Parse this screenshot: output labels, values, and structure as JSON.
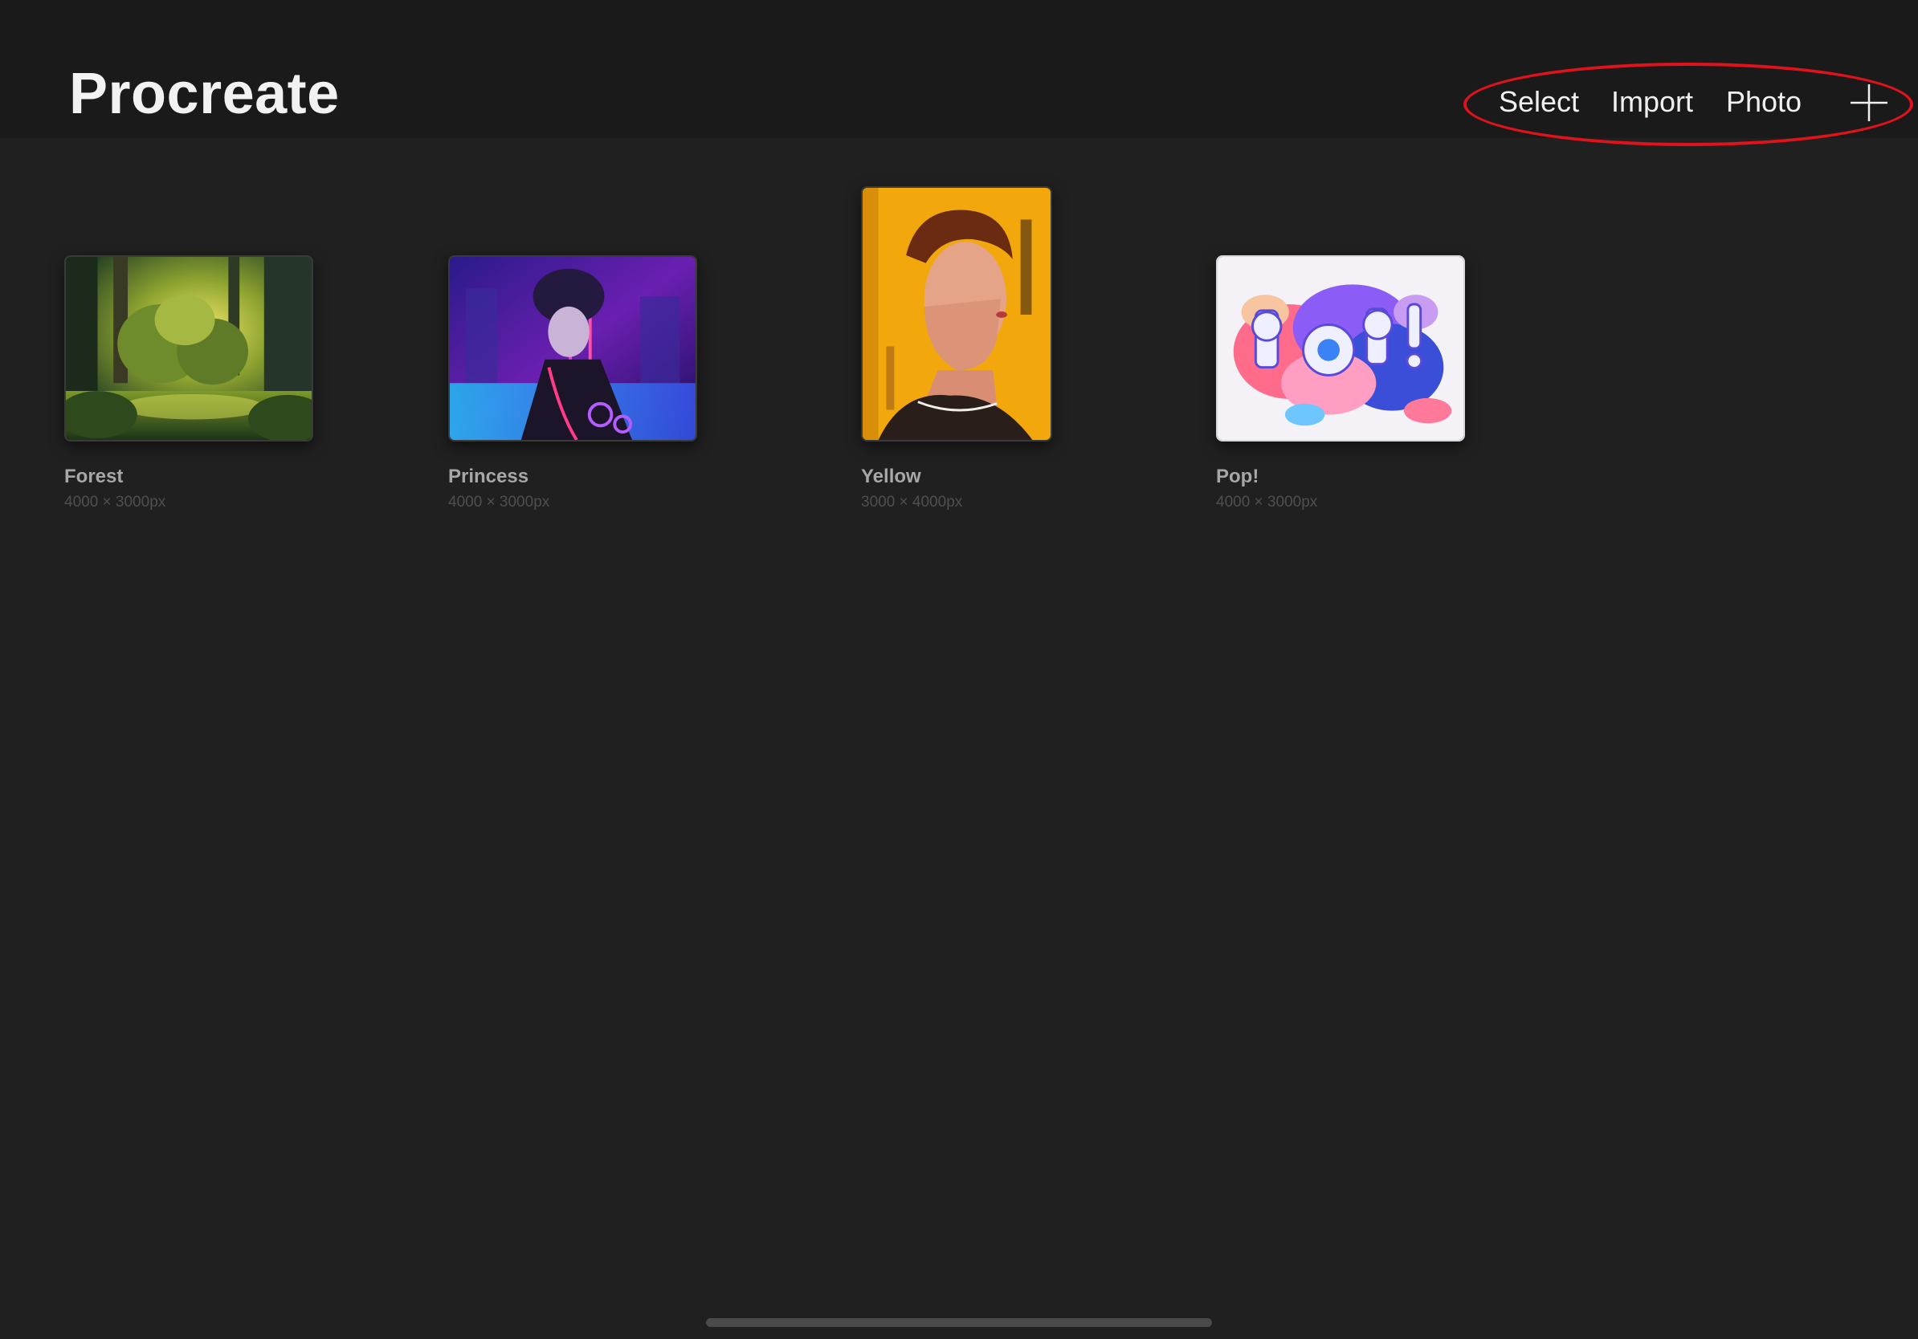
{
  "app": {
    "title": "Procreate"
  },
  "toolbar": {
    "select_label": "Select",
    "import_label": "Import",
    "photo_label": "Photo",
    "new_icon": "plus-icon"
  },
  "colors": {
    "background": "#202020",
    "header_bg": "#1a1a1a",
    "highlight_ring": "#e0121c"
  },
  "gallery": {
    "artworks": [
      {
        "name": "Forest",
        "size": "4000 × 3000px"
      },
      {
        "name": "Princess",
        "size": "4000 × 3000px"
      },
      {
        "name": "Yellow",
        "size": "3000 × 4000px"
      },
      {
        "name": "Pop!",
        "size": "4000 × 3000px"
      }
    ]
  }
}
